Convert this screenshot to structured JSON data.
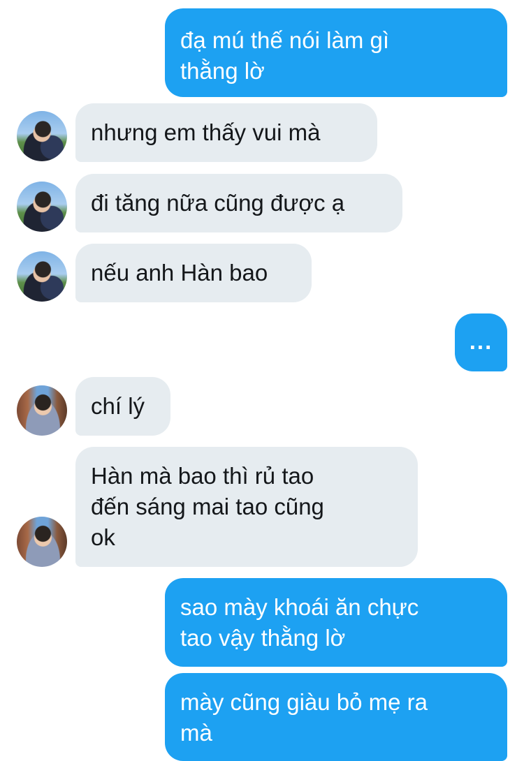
{
  "messages": [
    {
      "direction": "outgoing",
      "text": "đạ mú thế nói làm gì\nthằng lờ"
    },
    {
      "direction": "incoming",
      "sender_avatar": "avatar-a",
      "text": "nhưng em thấy vui mà"
    },
    {
      "direction": "incoming",
      "sender_avatar": "avatar-a",
      "text": "đi tăng nữa cũng được ạ"
    },
    {
      "direction": "incoming",
      "sender_avatar": "avatar-a",
      "text": "nếu anh Hàn bao"
    },
    {
      "direction": "outgoing",
      "text": "..."
    },
    {
      "direction": "incoming",
      "sender_avatar": "avatar-b",
      "text": "chí lý"
    },
    {
      "direction": "incoming",
      "sender_avatar": "avatar-b",
      "text": "Hàn mà bao thì rủ tao\nđến sáng mai tao cũng\nok"
    },
    {
      "direction": "outgoing",
      "text": "sao mày khoái ăn chực\ntao vậy thằng lờ"
    },
    {
      "direction": "outgoing",
      "text": "mày cũng giàu bỏ mẹ ra\nmà"
    }
  ],
  "colors": {
    "outgoing_bubble": "#1da1f2",
    "incoming_bubble": "#e6ecf0",
    "incoming_text": "#14171a",
    "outgoing_text": "#ffffff"
  }
}
